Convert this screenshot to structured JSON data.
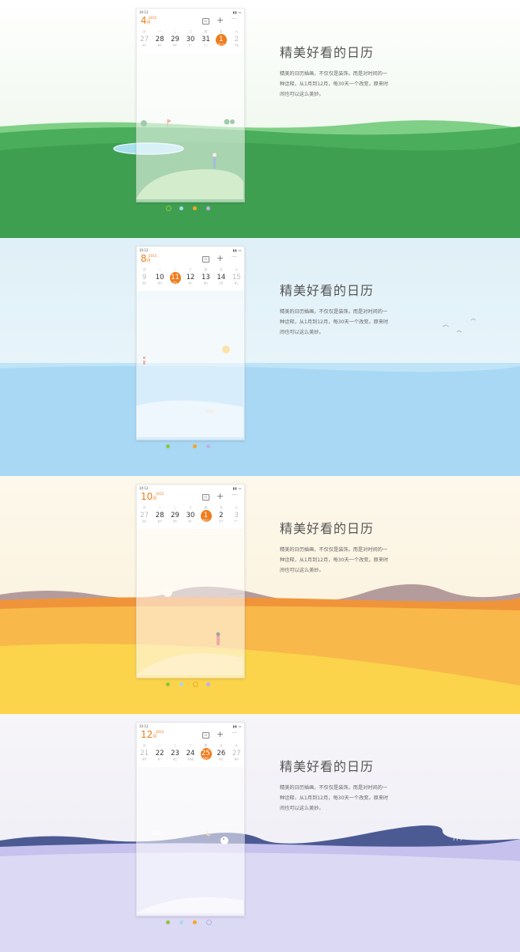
{
  "tagline": {
    "title": "精美好看的日历",
    "description": "精美的日历插画，不仅仅是装饰。而是对时间的一种诠释，从1月到12月，每30天一个改变。原来时间也可以这么美妙。"
  },
  "status_time": "10:12",
  "weekdays": [
    "日",
    "一",
    "二",
    "三",
    "四",
    "五",
    "六"
  ],
  "panels": [
    {
      "month": "4",
      "month_unit": "月",
      "year": "2015",
      "days": [
        {
          "n": "27",
          "l": "初八",
          "dim": true
        },
        {
          "n": "28",
          "l": "初九",
          "dim": false
        },
        {
          "n": "29",
          "l": "初十",
          "dim": false
        },
        {
          "n": "30",
          "l": "十一",
          "dim": false
        },
        {
          "n": "31",
          "l": "十二",
          "dim": false
        },
        {
          "n": "1",
          "l": "愚人节",
          "dim": false,
          "sel": true
        },
        {
          "n": "2",
          "l": "十四",
          "dim": true
        }
      ]
    },
    {
      "month": "8",
      "month_unit": "月",
      "year": "2015",
      "days": [
        {
          "n": "9",
          "l": "廿五",
          "dim": true
        },
        {
          "n": "10",
          "l": "廿六",
          "dim": false
        },
        {
          "n": "11",
          "l": "廿七",
          "dim": false,
          "sel": true
        },
        {
          "n": "12",
          "l": "廿八",
          "dim": false
        },
        {
          "n": "13",
          "l": "廿九",
          "dim": false
        },
        {
          "n": "14",
          "l": "七月",
          "dim": false
        },
        {
          "n": "15",
          "l": "初二",
          "dim": true
        }
      ]
    },
    {
      "month": "10",
      "month_unit": "月",
      "year": "2015",
      "days": [
        {
          "n": "27",
          "l": "初五",
          "dim": true
        },
        {
          "n": "28",
          "l": "初六",
          "dim": false
        },
        {
          "n": "29",
          "l": "初七",
          "dim": false
        },
        {
          "n": "30",
          "l": "初八",
          "dim": false
        },
        {
          "n": "1",
          "l": "国庆节",
          "dim": false,
          "sel": true
        },
        {
          "n": "2",
          "l": "初十",
          "dim": false
        },
        {
          "n": "3",
          "l": "十一",
          "dim": true
        }
      ]
    },
    {
      "month": "12",
      "month_unit": "月",
      "year": "2014",
      "days": [
        {
          "n": "21",
          "l": "冬至",
          "dim": true
        },
        {
          "n": "22",
          "l": "初一",
          "dim": false
        },
        {
          "n": "23",
          "l": "初二",
          "dim": false
        },
        {
          "n": "24",
          "l": "平安夜",
          "dim": false
        },
        {
          "n": "25",
          "l": "圣诞节",
          "dim": false,
          "sel": true
        },
        {
          "n": "26",
          "l": "初五",
          "dim": false
        },
        {
          "n": "27",
          "l": "初六",
          "dim": true
        }
      ]
    }
  ],
  "dot_colors": [
    "#8cc63f",
    "#a8d8ef",
    "#f5a623",
    "#b9b2e6"
  ],
  "icons": {
    "calendar": "calendar-icon",
    "add": "plus-icon",
    "more": "more-icon",
    "signal": "signal-battery-icon"
  },
  "colors": {
    "accent": "#f07c1c",
    "spring": "#4caf63",
    "summer": "#a9d8f5",
    "autumn": "#f6c244",
    "winter": "#ccc6ee"
  }
}
